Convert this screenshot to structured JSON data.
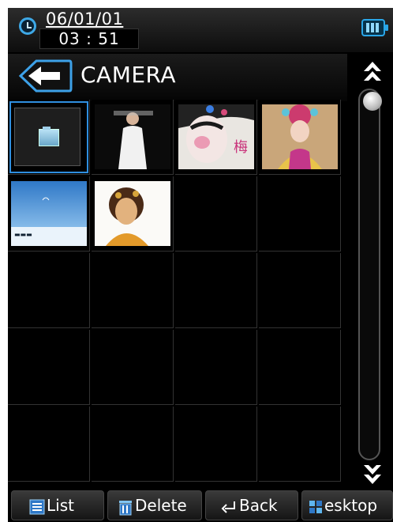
{
  "status": {
    "date": "06/01/01",
    "time": "03 : 51"
  },
  "header": {
    "title": "CAMERA"
  },
  "grid": {
    "items": [
      {
        "type": "folder"
      },
      {
        "type": "photo",
        "subject": "woman-white-dress"
      },
      {
        "type": "photo",
        "subject": "opera-face"
      },
      {
        "type": "photo",
        "subject": "opera-costume"
      },
      {
        "type": "photo",
        "subject": "blue-sky"
      },
      {
        "type": "photo",
        "subject": "woman-portrait"
      }
    ]
  },
  "toolbar": {
    "list_label": "List",
    "delete_label": "Delete",
    "back_label": "Back",
    "desktop_label": "esktop"
  },
  "colors": {
    "accent": "#2f8fe0",
    "background": "#000000"
  }
}
